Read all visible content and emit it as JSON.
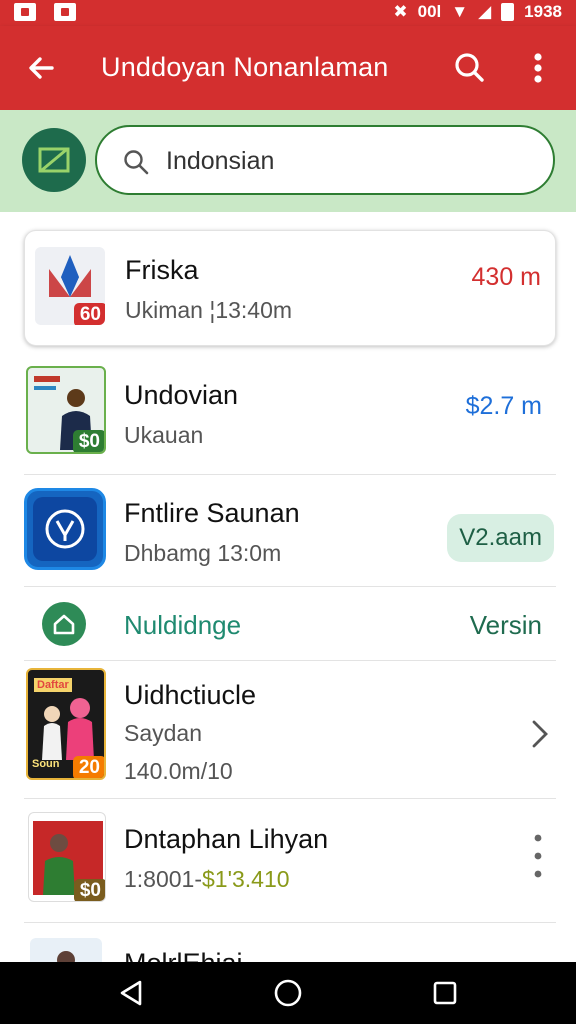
{
  "status_bar": {
    "net": "00l",
    "time": "1938"
  },
  "app_bar": {
    "title": "Unddoyan Nonanlaman"
  },
  "search": {
    "value": "Indonsian",
    "placeholder": "Indonsian"
  },
  "items": [
    {
      "title": "Friska",
      "subtitle": "Ukiman ¦13:40m",
      "value": "430 m",
      "badge": "60"
    },
    {
      "title": "Undovian",
      "subtitle": "Ukauan",
      "value": "$2.7 m",
      "badge": "$0"
    },
    {
      "title": "Fntlire Saunan",
      "subtitle": "Dhbamg 13:0m",
      "chip": "V2.aam"
    },
    {
      "title": "Uidhctiucle",
      "subtitle": "Saydan",
      "subtitle2": "140.0m/10",
      "badge": "20",
      "thumb_text": "Daftar",
      "thumb_caption": "Soun"
    },
    {
      "title": "Dntaphan Lihyan",
      "subtitle": "1:8001-",
      "subtitle_price": "$1'3.410",
      "badge": "$0"
    },
    {
      "title": "MolrlEhiai"
    }
  ],
  "section": {
    "title": "Nuldidnge",
    "action": "Versin"
  },
  "colors": {
    "primary": "#d32f2f",
    "accent_green": "#2e7d32",
    "search_bg": "#c9e8c6",
    "price_red": "#d32f2f",
    "price_blue": "#1e6fd9"
  }
}
